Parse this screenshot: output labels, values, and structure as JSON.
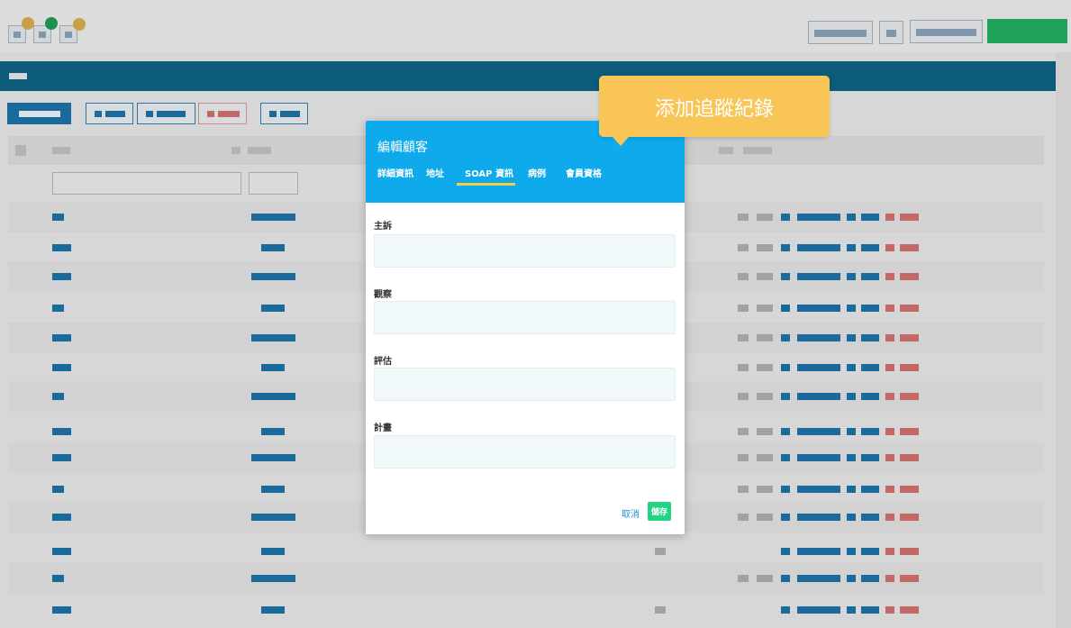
{
  "modal": {
    "title": "編輯顧客",
    "tabs": [
      {
        "label": "詳細資訊"
      },
      {
        "label": "地址"
      },
      {
        "label": "SOAP 資訊",
        "active": true
      },
      {
        "label": "病例"
      },
      {
        "label": "會員資格"
      }
    ],
    "fields": [
      {
        "label": "主訴",
        "value": ""
      },
      {
        "label": "觀察",
        "value": ""
      },
      {
        "label": "評估",
        "value": ""
      },
      {
        "label": "計畫",
        "value": ""
      }
    ],
    "cancel_label": "取消",
    "save_label": "儲存"
  },
  "tooltip": {
    "text": "添加追蹤紀錄"
  },
  "colors": {
    "modal_header": "#0eaaec",
    "active_tab_underline": "#f7cf46",
    "tooltip": "#f8c556",
    "save_button": "#22d482",
    "cancel_link": "#1e8fd6",
    "field_background": "#f0f8fa"
  },
  "icons": {
    "window_controls": [
      "window-control-dot",
      "window-control-dot",
      "window-control-dot"
    ]
  }
}
